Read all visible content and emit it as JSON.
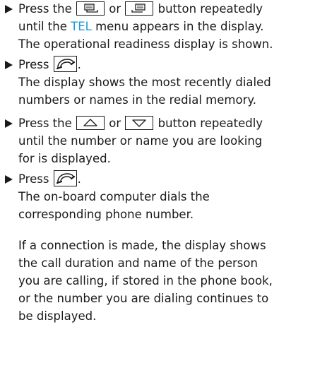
{
  "steps": [
    {
      "text_a": "Press the ",
      "text_or": " or ",
      "text_b": " button repeatedly",
      "line2_a": "until the ",
      "menu_name": "TEL",
      "line2_b": " menu appears in the display.",
      "line3": "The operational readiness display is shown."
    },
    {
      "text_a": "Press ",
      "text_b": ".",
      "line2": "The display shows the most recently dialed",
      "line3": "numbers or names in the redial memory."
    },
    {
      "text_a": "Press the ",
      "text_or": " or ",
      "text_b": " button repeatedly",
      "line2": "until the number or name you are looking",
      "line3": "for is displayed."
    },
    {
      "text_a": "Press ",
      "text_b": ".",
      "line2": "The on-board computer dials the",
      "line3": "corresponding phone number."
    }
  ],
  "paragraph": [
    "If a connection is made, the display shows",
    "the call duration and name of the person",
    "you are calling, if stored in the phone book,",
    "or the number you are dialing continues to",
    "be displayed."
  ],
  "icons": {
    "display_left": "display-left-icon",
    "display_right": "display-right-icon",
    "phone": "phone-handset-icon",
    "arrow_up": "arrow-up-icon",
    "arrow_down": "arrow-down-icon"
  },
  "colors": {
    "text": "#1a1a1a",
    "menu_highlight": "#1a9bd7"
  }
}
